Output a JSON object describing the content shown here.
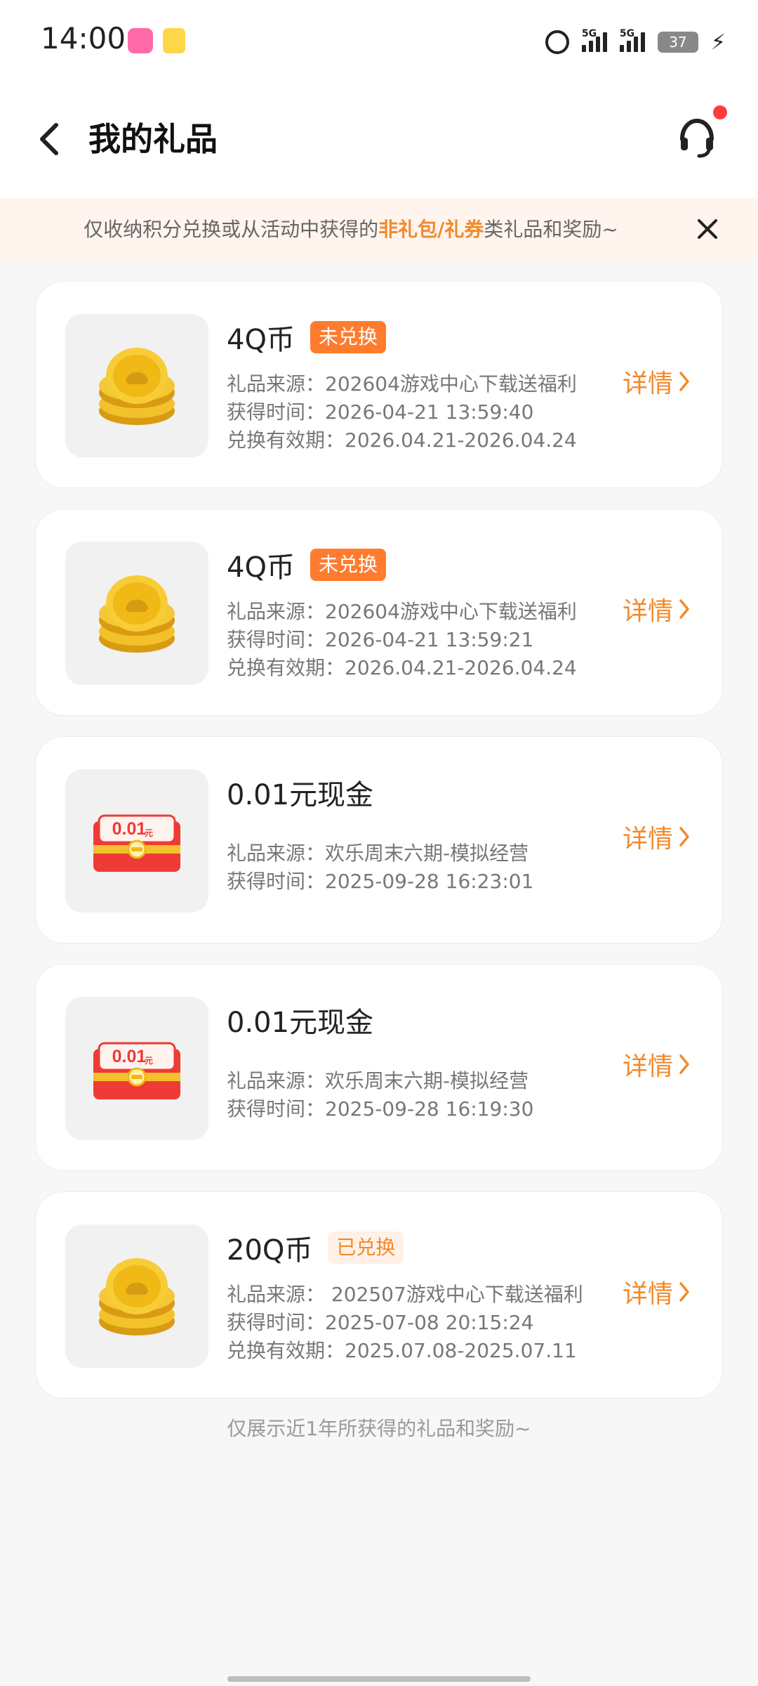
{
  "status_bar": {
    "time": "14:00",
    "sim1": "5G",
    "sim2": "5G",
    "battery": "37"
  },
  "header": {
    "title": "我的礼品"
  },
  "notice": {
    "before": "仅收纳积分兑换或从活动中获得的",
    "highlight": "非礼包/礼券",
    "after": "类礼品和奖励~"
  },
  "gifts": [
    {
      "title": "4Q币",
      "badge": "未兑换",
      "source": "礼品来源：202604游戏中心下载送福利",
      "time": "获得时间：2026-04-21 13:59:40",
      "validity": "兑换有效期：2026.04.21-2026.04.24",
      "detail": "详情",
      "image_type": "coin"
    },
    {
      "title": "4Q币",
      "badge": "未兑换",
      "source": "礼品来源：202604游戏中心下载送福利",
      "time": "获得时间：2026-04-21 13:59:21",
      "validity": "兑换有效期：2026.04.21-2026.04.24",
      "detail": "详情",
      "image_type": "coin"
    },
    {
      "title": "0.01元现金",
      "source": "礼品来源：欢乐周末六期-模拟经营",
      "time": "获得时间：2025-09-28 16:23:01",
      "detail": "详情",
      "image_type": "cash"
    },
    {
      "title": "0.01元现金",
      "source": "礼品来源：欢乐周末六期-模拟经营",
      "time": "获得时间：2025-09-28 16:19:30",
      "detail": "详情",
      "image_type": "cash"
    },
    {
      "title": "20Q币",
      "badge": "已兑换",
      "source": "礼品来源： 202507游戏中心下载送福利",
      "time": "获得时间：2025-07-08 20:15:24",
      "validity": "兑换有效期：2025.07.08-2025.07.11",
      "detail": "详情",
      "image_type": "coin"
    }
  ],
  "footer_note": "仅展示近1年所获得的礼品和奖励~",
  "cash_art": {
    "amount": "0.01",
    "unit": "元"
  },
  "icons": {
    "back": "back-arrow-icon",
    "support": "headset-icon",
    "close": "close-icon",
    "detail": "chevron-right-icon"
  }
}
